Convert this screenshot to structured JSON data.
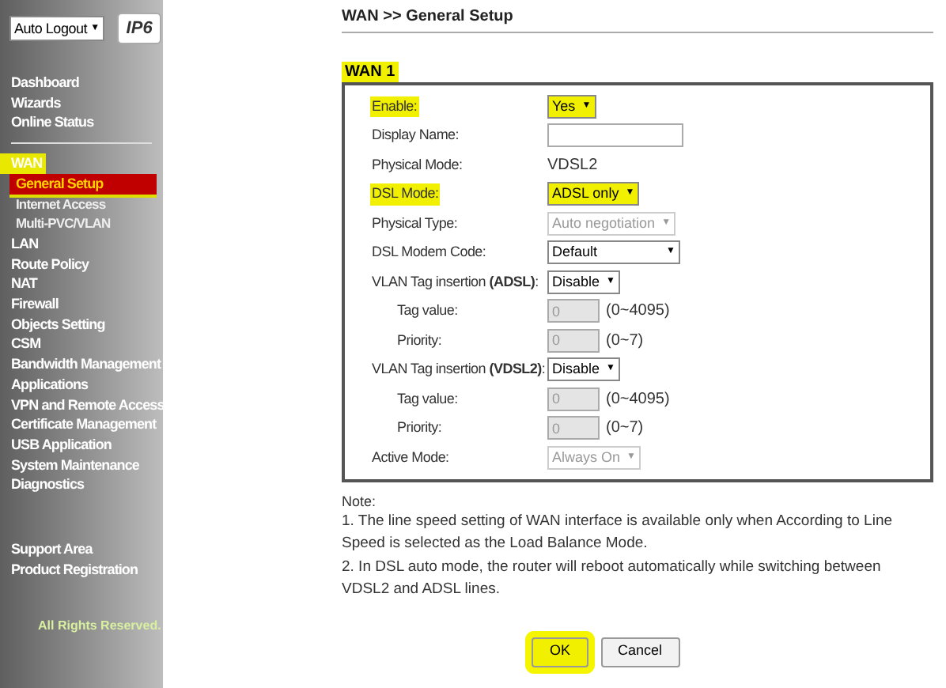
{
  "top_controls": {
    "auto_logout": "Auto Logout",
    "auto_logout_caret": "▼",
    "ipv6_badge": "IP6"
  },
  "sidebar": {
    "groups": [
      [
        {
          "label": "Dashboard",
          "selected": false,
          "highlighted": false
        },
        {
          "label": "Wizards",
          "selected": false,
          "highlighted": false
        },
        {
          "label": "Online Status",
          "selected": false,
          "highlighted": false
        }
      ],
      [
        {
          "label": "WAN",
          "selected": false,
          "highlighted": true,
          "children": [
            {
              "label": "General Setup",
              "selected": true,
              "highlighted": true
            },
            {
              "label": "Internet Access",
              "selected": false,
              "highlighted": false
            },
            {
              "label": "Multi-PVC/VLAN",
              "selected": false,
              "highlighted": false
            }
          ]
        },
        {
          "label": "LAN",
          "selected": false,
          "highlighted": false
        },
        {
          "label": "Route Policy",
          "selected": false,
          "highlighted": false
        },
        {
          "label": "NAT",
          "selected": false,
          "highlighted": false
        },
        {
          "label": "Firewall",
          "selected": false,
          "highlighted": false
        },
        {
          "label": "Objects Setting",
          "selected": false,
          "highlighted": false
        },
        {
          "label": "CSM",
          "selected": false,
          "highlighted": false
        },
        {
          "label": "Bandwidth Management",
          "selected": false,
          "highlighted": false
        },
        {
          "label": "Applications",
          "selected": false,
          "highlighted": false
        },
        {
          "label": "VPN and Remote Access",
          "selected": false,
          "highlighted": false
        },
        {
          "label": "Certificate Management",
          "selected": false,
          "highlighted": false
        },
        {
          "label": "USB Application",
          "selected": false,
          "highlighted": false
        },
        {
          "label": "System Maintenance",
          "selected": false,
          "highlighted": false
        },
        {
          "label": "Diagnostics",
          "selected": false,
          "highlighted": false
        }
      ],
      [
        {
          "label": "Support Area",
          "selected": false,
          "highlighted": false
        },
        {
          "label": "Product Registration",
          "selected": false,
          "highlighted": false
        }
      ]
    ],
    "footer": "All Rights Reserved."
  },
  "breadcrumb": "WAN >> General Setup",
  "section": {
    "title": "WAN 1",
    "highlighted": true
  },
  "rows": [
    {
      "label": "Enable:",
      "kind": "select",
      "value": "Yes",
      "caret": "▼",
      "disabled": false,
      "highlighted": true
    },
    {
      "label": "Display Name:",
      "kind": "input",
      "disabled": false,
      "highlighted": false
    },
    {
      "label": "Physical Mode:",
      "kind": "text",
      "value": "VDSL2",
      "highlighted": false
    },
    {
      "label": "DSL Mode:",
      "kind": "select",
      "value": "ADSL only",
      "caret": "▼",
      "disabled": false,
      "highlighted": true
    },
    {
      "label": "Physical Type:",
      "kind": "select",
      "value": "Auto negotiation",
      "caret": "▼",
      "disabled": true,
      "highlighted": false
    },
    {
      "label": "DSL Modem Code:",
      "kind": "select",
      "value": "Default",
      "caret": "▼",
      "disabled": false,
      "highlighted": false,
      "wide": true
    },
    {
      "label": "VLAN Tag insertion **(ADSL)**:",
      "kind": "select",
      "value": "Disable",
      "caret": "▼",
      "disabled": false,
      "highlighted": false
    },
    {
      "label": "Tag value:",
      "kind": "input",
      "value": "0",
      "hint": "(0~4095)",
      "disabled": true,
      "highlighted": false,
      "indented": true
    },
    {
      "label": "Priority:",
      "kind": "input",
      "value": "0",
      "hint": "(0~7)",
      "disabled": true,
      "highlighted": false,
      "indented": true
    },
    {
      "label": "VLAN Tag insertion **(VDSL2)**:",
      "kind": "select",
      "value": "Disable",
      "caret": "▼",
      "disabled": false,
      "highlighted": false
    },
    {
      "label": "Tag value:",
      "kind": "input",
      "value": "0",
      "hint": "(0~4095)",
      "disabled": true,
      "highlighted": false,
      "indented": true
    },
    {
      "label": "Priority:",
      "kind": "input",
      "value": "0",
      "hint": "(0~7)",
      "disabled": true,
      "highlighted": false,
      "indented": true
    },
    {
      "label": "Active Mode:",
      "kind": "select",
      "value": "Always On",
      "caret": "▼",
      "disabled": true,
      "highlighted": false
    }
  ],
  "note": {
    "title": "Note:",
    "items": [
      "1. The line speed setting of WAN interface is available only when According to Line Speed is selected as the Load Balance Mode.",
      "2. In DSL auto mode, the router will reboot automatically while switching between VDSL2 and ADSL lines."
    ]
  },
  "buttons": [
    {
      "label": "OK",
      "highlighted": true
    },
    {
      "label": "Cancel",
      "highlighted": false
    }
  ]
}
